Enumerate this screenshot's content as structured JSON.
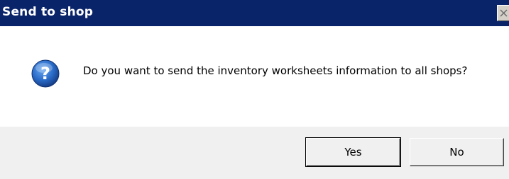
{
  "window": {
    "title": "Send to shop",
    "close_icon": "close-icon"
  },
  "dialog": {
    "icon": "question-icon",
    "message": "Do you want to send the inventory worksheets information to all shops?"
  },
  "buttons": {
    "yes_label": "Yes",
    "no_label": "No"
  },
  "colors": {
    "titlebar": "#0a246a",
    "icon_blue": "#1f5fb6",
    "footer": "#f0f0f0"
  }
}
